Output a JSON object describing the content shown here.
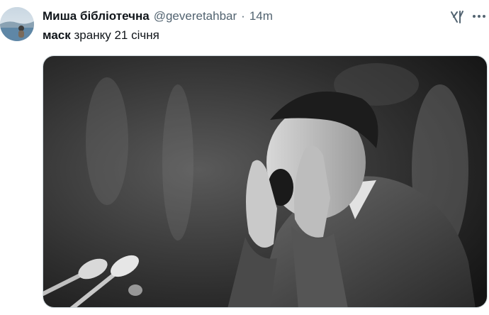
{
  "tweet": {
    "display_name": "Миша бібліотечна",
    "handle": "@geveretahbar",
    "separator": "·",
    "time": "14m",
    "text_bold": "маск",
    "text_rest": " зранку 21 січня"
  },
  "icons": {
    "avatar": "avatar-photo",
    "grok": "grok-icon",
    "more": "more-options-icon"
  },
  "media": {
    "kind": "black-and-white photo",
    "content": "man shouting at microphones with hands cupped to mouth"
  },
  "colors": {
    "text_primary": "#0f1419",
    "text_secondary": "#536471",
    "border": "#cfd9de"
  }
}
